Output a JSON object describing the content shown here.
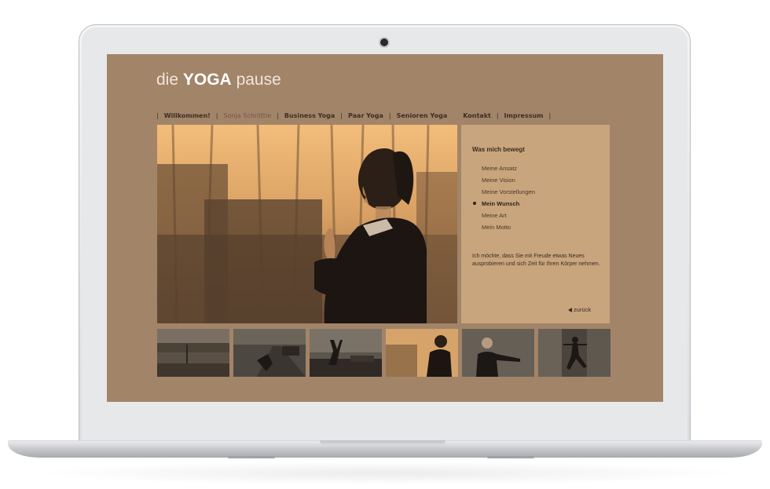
{
  "site": {
    "title_prefix": "die",
    "title_bold": "YOGA",
    "title_suffix": "pause"
  },
  "nav": {
    "items": [
      {
        "label": "Willkommen!",
        "active": false
      },
      {
        "label": "Sonja Schröttle",
        "active": true
      },
      {
        "label": "Business Yoga",
        "active": false
      },
      {
        "label": "Paar Yoga",
        "active": false
      },
      {
        "label": "Senioren Yoga",
        "active": false
      },
      {
        "label": "Kontakt",
        "active": false
      },
      {
        "label": "Impressum",
        "active": false
      }
    ],
    "separator": "|"
  },
  "panel": {
    "heading": "Was mich bewegt",
    "menu": [
      {
        "label": "Meine Ansatz",
        "active": false
      },
      {
        "label": "Meine Vision",
        "active": false
      },
      {
        "label": "Meine Vorstellungen",
        "active": false
      },
      {
        "label": "Mein Wunsch",
        "active": true
      },
      {
        "label": "Meine Art",
        "active": false
      },
      {
        "label": "Mein Motto",
        "active": false
      }
    ],
    "text": "Ich möchte, dass Sie mit Freude etwas Neues ausprobieren und sich Zeit für Ihren Körper nehmen.",
    "back_label": "zurück"
  },
  "colors": {
    "page_background": "#a28469",
    "panel_background": "#c8a57d",
    "text_dark": "#3b2c20"
  },
  "thumbnails": [
    {
      "icon": "street-photo"
    },
    {
      "icon": "road-pose-photo"
    },
    {
      "icon": "arms-raised-photo"
    },
    {
      "icon": "praying-woman-photo"
    },
    {
      "icon": "stretching-woman-photo"
    },
    {
      "icon": "warrior-pose-photo"
    }
  ]
}
